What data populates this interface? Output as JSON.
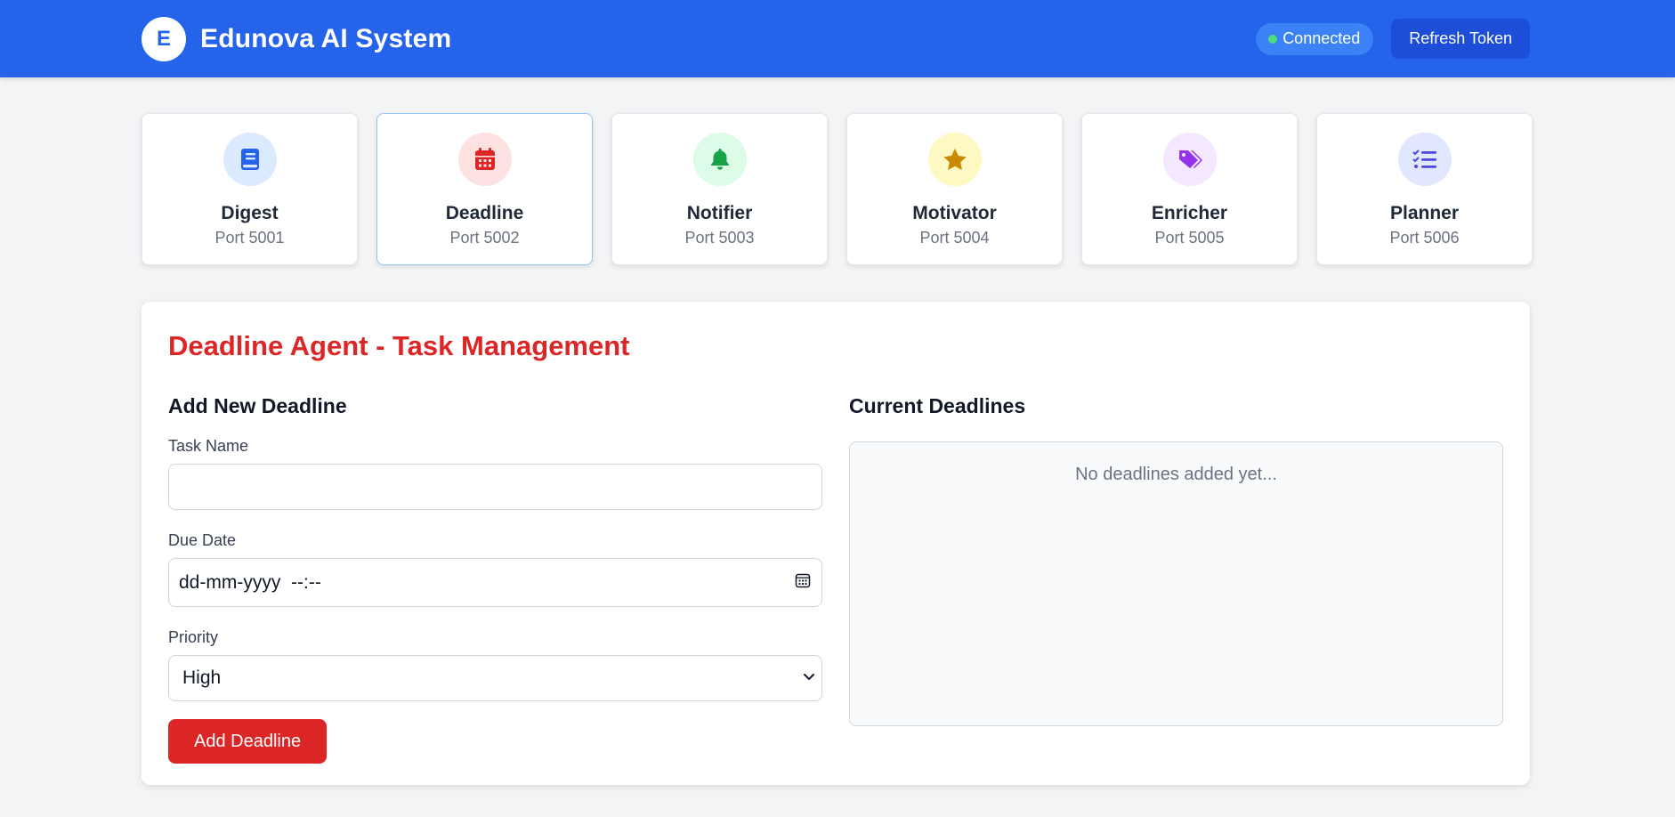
{
  "header": {
    "logo_letter": "E",
    "title": "Edunova AI System",
    "status": "Connected",
    "refresh_label": "Refresh Token"
  },
  "agents": [
    {
      "name": "Digest",
      "port": "Port 5001",
      "icon": "book-icon",
      "color": "#2563eb",
      "bg": "#dbeafe"
    },
    {
      "name": "Deadline",
      "port": "Port 5002",
      "icon": "calendar-icon",
      "color": "#dc2626",
      "bg": "#fee2e2",
      "active": true
    },
    {
      "name": "Notifier",
      "port": "Port 5003",
      "icon": "bell-icon",
      "color": "#16a34a",
      "bg": "#dcfce7"
    },
    {
      "name": "Motivator",
      "port": "Port 5004",
      "icon": "star-icon",
      "color": "#ca8a04",
      "bg": "#fef9c3"
    },
    {
      "name": "Enricher",
      "port": "Port 5005",
      "icon": "tags-icon",
      "color": "#9333ea",
      "bg": "#f3e8ff"
    },
    {
      "name": "Planner",
      "port": "Port 5006",
      "icon": "list-check-icon",
      "color": "#4f46e5",
      "bg": "#e0e7ff"
    }
  ],
  "panel": {
    "title": "Deadline Agent - Task Management",
    "form": {
      "heading": "Add New Deadline",
      "task_label": "Task Name",
      "task_value": "",
      "due_label": "Due Date",
      "due_placeholder": "dd-mm-yyyy  --:--",
      "priority_label": "Priority",
      "priority_value": "High",
      "submit_label": "Add Deadline"
    },
    "list": {
      "heading": "Current Deadlines",
      "empty_text": "No deadlines added yet..."
    }
  },
  "colors": {
    "header_bg": "#2563eb",
    "accent_red": "#dc2626",
    "status_dot": "#4ade80"
  }
}
